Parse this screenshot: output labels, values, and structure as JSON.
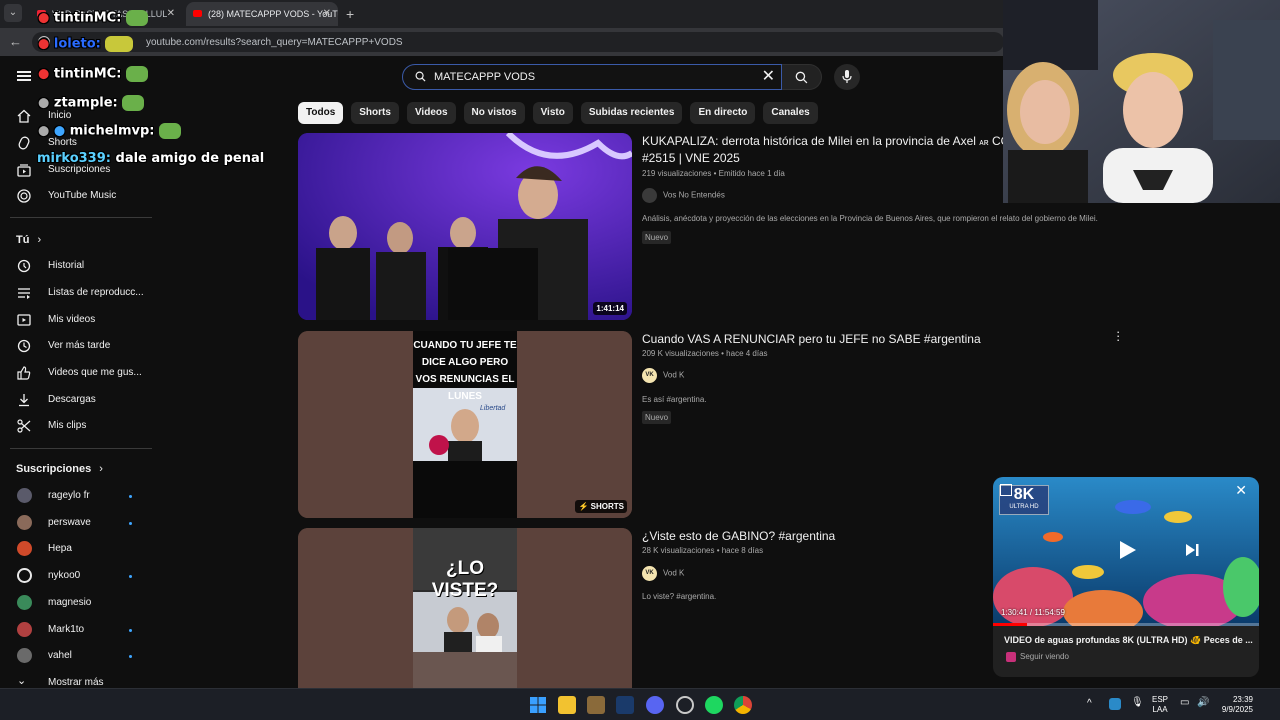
{
  "browser": {
    "tabs": [
      {
        "title": "VOD CASTLE TASUSI LLUL"
      },
      {
        "title": "(28) MATECAPPP VODS - YouTube"
      }
    ],
    "url": "youtube.com/results?search_query=MATECAPPP+VODS"
  },
  "search": {
    "value": "MATECAPPP VODS"
  },
  "chips": [
    "Todos",
    "Shorts",
    "Videos",
    "No vistos",
    "Visto",
    "Subidas recientes",
    "En directo",
    "Canales"
  ],
  "sidebar": {
    "main": [
      {
        "label": "Inicio",
        "icon": "home-icon"
      },
      {
        "label": "Shorts",
        "icon": "shorts-icon"
      },
      {
        "label": "Suscripciones",
        "icon": "subscriptions-icon"
      },
      {
        "label": "YouTube Music",
        "icon": "youtube-music-icon"
      }
    ],
    "you_heading": "Tú",
    "you": [
      {
        "label": "Historial",
        "icon": "history-icon"
      },
      {
        "label": "Listas de reproducc...",
        "icon": "playlists-icon"
      },
      {
        "label": "Mis videos",
        "icon": "my-videos-icon"
      },
      {
        "label": "Ver más tarde",
        "icon": "watch-later-icon"
      },
      {
        "label": "Videos que me gus...",
        "icon": "liked-icon"
      },
      {
        "label": "Descargas",
        "icon": "downloads-icon"
      },
      {
        "label": "Mis clips",
        "icon": "clips-icon"
      }
    ],
    "subs_heading": "Suscripciones",
    "subs": [
      {
        "label": "rageylo fr",
        "color": "#5a5a6a"
      },
      {
        "label": "perswave",
        "color": "#8a6a5a"
      },
      {
        "label": "Hepa",
        "color": "#d04a2a"
      },
      {
        "label": "nykoo0",
        "color": "#e8e8e8"
      },
      {
        "label": "magnesio",
        "color": "#3a8a5a"
      },
      {
        "label": "Mark1to",
        "color": "#b04040"
      },
      {
        "label": "vahel",
        "color": "#6a6a6a"
      }
    ],
    "show_more": "Mostrar más"
  },
  "results": [
    {
      "title_line1": "KUKAPALIZA: derrota histórica de Milei en la provincia de Axel",
      "title_small": "ᴀʀ",
      "title_cut": "CO",
      "title_line2": "#2515 | VNE 2025",
      "meta": "219 visualizaciones • Emitido hace 1 día",
      "channel": "Vos No Entendés",
      "description": "Análisis, anécdota y proyección de las elecciones en la Provincia de Buenos Aires, que rompieron el relato del gobierno de Milei.",
      "badge": "Nuevo",
      "duration": "1:41:14"
    },
    {
      "title_line1": "Cuando VAS A RENUNCIAR pero tu JEFE no SABE #argentina",
      "meta": "209 K visualizaciones • hace 4 días",
      "channel": "Vod K",
      "channel_initials": "VK",
      "description": "Es así #argentina.",
      "badge": "Nuevo",
      "thumb_caption": "CUANDO TU JEFE TE DICE ALGO PERO VOS RENUNCIAS EL LUNES",
      "thumb_sign": "Libertad",
      "shorts_label": "SHORTS"
    },
    {
      "title_line1": "¿Viste esto de GABINO? #argentina",
      "meta": "28 K visualizaciones • hace 8 días",
      "channel": "Vod K",
      "channel_initials": "VK",
      "description": "Lo viste? #argentina.",
      "thumb_caption": "¿LO VISTE?"
    }
  ],
  "chat": [
    {
      "user": "tintinMC:",
      "text": "",
      "color": "#ffffff"
    },
    {
      "user": "loleto:",
      "text": "",
      "color": "#2a6bff"
    },
    {
      "user": "tintinMC:",
      "text": "",
      "color": "#ffffff"
    },
    {
      "user": "ztample:",
      "text": "",
      "color": "#ffffff"
    },
    {
      "user": "michelmvp:",
      "text": "",
      "color": "#ffffff"
    },
    {
      "user": "mirko339:",
      "text": "dale amigo de penal",
      "color": "#5ad0ff"
    }
  ],
  "miniplayer": {
    "time": "1:30:41 / 11:54:59",
    "quality_badge": "8K",
    "quality_sub": "ULTRA HD",
    "title": "VIDEO de aguas profundas 8K (ULTRA HD) 🐠 Peces de ...",
    "subtitle": "Seguir viendo",
    "progress": 0.127
  },
  "taskbar": {
    "lang": "ESP",
    "lang2": "LAA",
    "time": "23:39",
    "date": "9/9/2025"
  },
  "colors": {
    "accent": "#3ea6ff",
    "brand": "#ff0000",
    "bg": "#0f0f0f"
  }
}
